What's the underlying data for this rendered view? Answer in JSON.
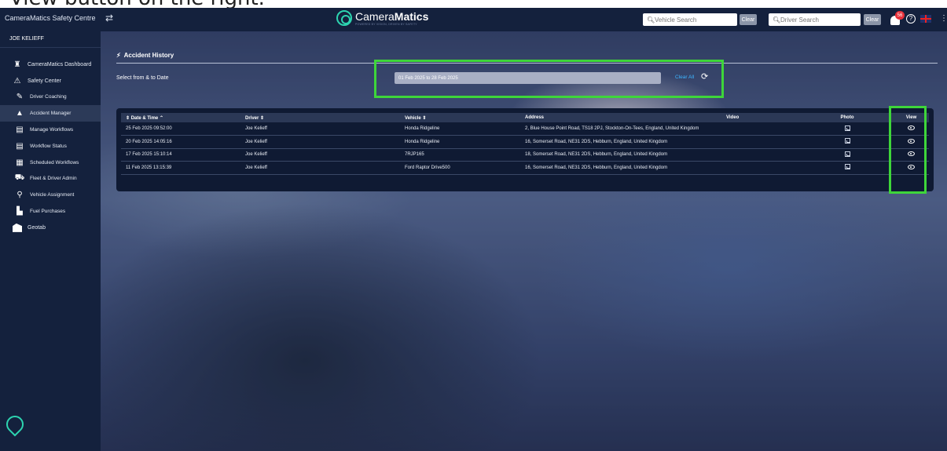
{
  "caption": "View button on the right.",
  "topbar": {
    "app_title": "CameraMatics Safety Centre",
    "swap_icon": "swap-arrows-icon",
    "logo_text_a": "Camera",
    "logo_text_b": "Matics",
    "logo_sub": "POWERED BY VISION, DRIVEN BY SAFETY",
    "vehicle_search_placeholder": "Vehicle Search",
    "driver_search_placeholder": "Driver Search",
    "clear_label": "Clear",
    "notification_count": "56",
    "language": "en-GB"
  },
  "sidebar": {
    "user": "JOE KELIEFF",
    "items": [
      {
        "label": "CameraMatics Dashboard",
        "icon": "dashboard-icon"
      },
      {
        "label": "Safety Center",
        "icon": "warning-icon"
      },
      {
        "label": "Driver Coaching",
        "icon": "coaching-icon"
      },
      {
        "label": "Accident Manager",
        "icon": "alert-icon",
        "active": true
      },
      {
        "label": "Manage Workflows",
        "icon": "workflow-icon"
      },
      {
        "label": "Workflow Status",
        "icon": "workflow-status-icon"
      },
      {
        "label": "Scheduled Workflows",
        "icon": "scheduled-icon"
      },
      {
        "label": "Fleet & Driver Admin",
        "icon": "car-icon"
      },
      {
        "label": "Vehicle Assignment",
        "icon": "assignment-icon"
      },
      {
        "label": "Fuel Purchases",
        "icon": "fuel-icon"
      },
      {
        "label": "Geotab",
        "icon": "geotab-icon"
      }
    ]
  },
  "page": {
    "title": "Accident History",
    "date_label": "Select from & to Date",
    "date_range": "01 Feb 2025 to 28 Feb 2025",
    "clear_all": "Clear All"
  },
  "table": {
    "headers": [
      "Date & Time",
      "Driver",
      "Vehicle",
      "Address",
      "Video",
      "Photo",
      "View"
    ],
    "rows": [
      {
        "datetime": "25 Feb 2025 09:52:00",
        "driver": "Joe Kelieff",
        "vehicle": "Honda Ridgeline",
        "address": "2, Blue House Point Road, TS18 2PJ, Stockton-On-Tees, England, United Kingdom"
      },
      {
        "datetime": "20 Feb 2025 14:05:16",
        "driver": "Joe Kelieff",
        "vehicle": "Honda Ridgeline",
        "address": "16, Somerset Road, NE31 2DS, Hebburn, England, United Kingdom"
      },
      {
        "datetime": "17 Feb 2025 15:10:14",
        "driver": "Joe Kelieff",
        "vehicle": "7RJP165",
        "address": "18, Somerset Road, NE31 2DS, Hebburn, England, United Kingdom"
      },
      {
        "datetime": "11 Feb 2025 13:15:39",
        "driver": "Joe Kelieff",
        "vehicle": "Ford Raptor Drive500",
        "address": "16, Somerset Road, NE31 2DS, Hebburn, England, United Kingdom"
      }
    ]
  },
  "colors": {
    "sidebar": "#14213d",
    "highlight": "#3ed63a",
    "accent_link": "#3db5ff",
    "brand_teal": "#2dd4b0"
  }
}
